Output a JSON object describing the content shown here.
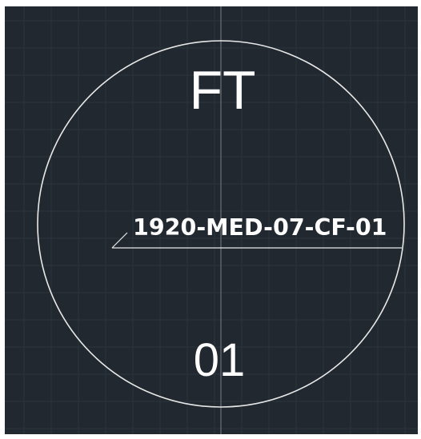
{
  "canvas": {
    "background_color": "#212830",
    "grid_color": "#2b333d",
    "axis_color": "#6b727a",
    "entity_color": "#ffffff"
  },
  "symbol": {
    "top_text": "FT",
    "bottom_text": "01",
    "label_text": "1920-MED-07-CF-01"
  }
}
